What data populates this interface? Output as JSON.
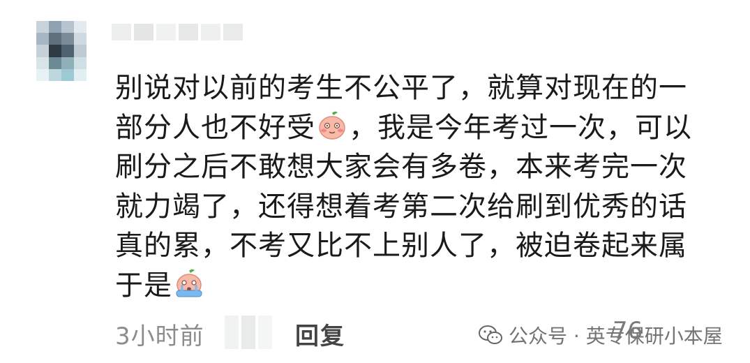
{
  "comment": {
    "lines": [
      "别说对以前的考生不公平了，就算对现在的一",
      "部分人也不好受",
      "，我是今年考过一次，可以",
      "刷分之后不敢想大家会有多卷，本来考完一次",
      "就力竭了，还得想着考第二次给刷到优秀的话",
      "真的累，不考又比不上别人了，被迫卷起来属",
      "于是"
    ],
    "emojis": [
      "blush-face-emoji",
      "crying-face-emoji"
    ]
  },
  "footer": {
    "timestamp": "3小时前",
    "reply_label": "回复",
    "like_count": "76"
  },
  "watermark": {
    "text": "公众号 · 英专保研小本屋",
    "icon": "wechat-icon"
  },
  "colors": {
    "text": "#1a1a1a",
    "muted": "#8c8c8c",
    "emoji_face": "#f7b9a8",
    "emoji_leaf": "#5aa84a"
  }
}
